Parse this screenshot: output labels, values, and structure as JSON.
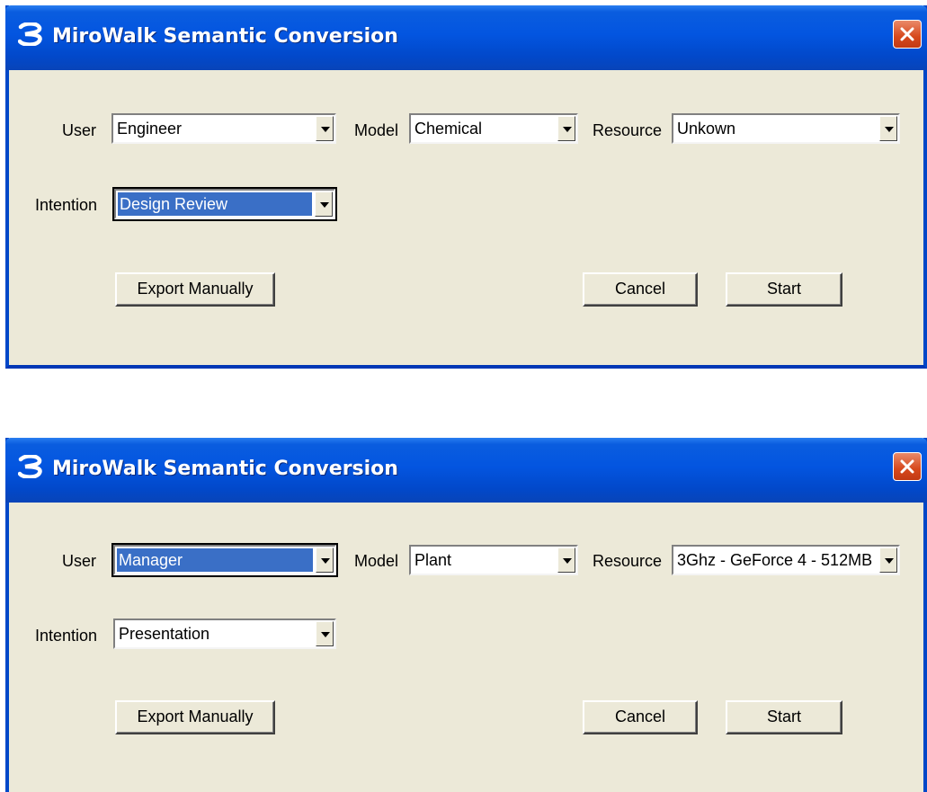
{
  "dialogs": [
    {
      "title": "MiroWalk Semantic Conversion",
      "fields": {
        "user": {
          "label": "User",
          "value": "Engineer"
        },
        "model": {
          "label": "Model",
          "value": "Chemical"
        },
        "resource": {
          "label": "Resource",
          "value": "Unkown"
        },
        "intention": {
          "label": "Intention",
          "value": "Design Review"
        }
      },
      "buttons": {
        "export": "Export Manually",
        "cancel": "Cancel",
        "start": "Start"
      }
    },
    {
      "title": "MiroWalk Semantic Conversion",
      "fields": {
        "user": {
          "label": "User",
          "value": "Manager"
        },
        "model": {
          "label": "Model",
          "value": "Plant"
        },
        "resource": {
          "label": "Resource",
          "value": "3Ghz - GeForce 4 - 512MB"
        },
        "intention": {
          "label": "Intention",
          "value": "Presentation"
        }
      },
      "buttons": {
        "export": "Export Manually",
        "cancel": "Cancel",
        "start": "Start"
      }
    }
  ],
  "colors": {
    "titlebar": "#0355e0",
    "selection": "#3a6fc6",
    "face": "#ece9d8"
  },
  "icons": {
    "app": "mirowalk-logo-icon",
    "close": "close-icon",
    "dropdown": "chevron-down-icon"
  }
}
